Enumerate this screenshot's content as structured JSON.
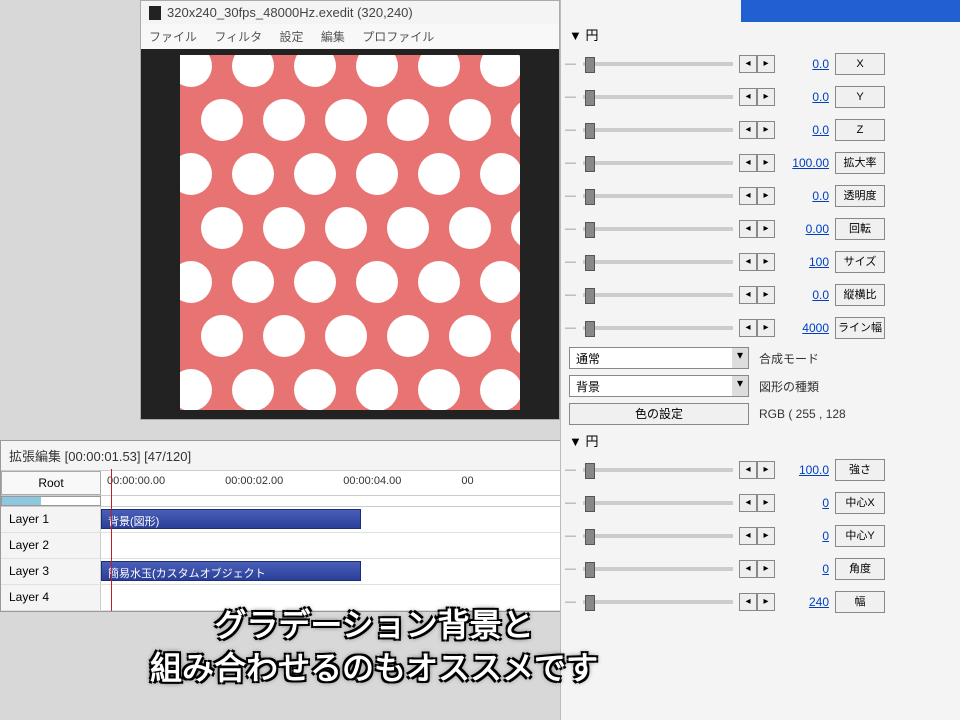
{
  "preview": {
    "title": "320x240_30fps_48000Hz.exedit (320,240)",
    "menu": [
      "ファイル",
      "フィルタ",
      "設定",
      "編集",
      "プロファイル"
    ]
  },
  "timeline": {
    "title": "拡張編集 [00:00:01.53] [47/120]",
    "root": "Root",
    "times": [
      "00:00:00.00",
      "00:00:02.00",
      "00:00:04.00",
      "00"
    ],
    "layers": [
      "Layer 1",
      "Layer 2",
      "Layer 3",
      "Layer 4"
    ],
    "clip1": "背景(図形)",
    "clip3": "簡易水玉(カスタムオブジェクト"
  },
  "panel": {
    "toggle1": "▼ 円",
    "params1": [
      {
        "val": "0.0",
        "btn": "X"
      },
      {
        "val": "0.0",
        "btn": "Y"
      },
      {
        "val": "0.0",
        "btn": "Z"
      },
      {
        "val": "100.00",
        "btn": "拡大率"
      },
      {
        "val": "0.0",
        "btn": "透明度"
      },
      {
        "val": "0.00",
        "btn": "回転"
      },
      {
        "val": "100",
        "btn": "サイズ"
      },
      {
        "val": "0.0",
        "btn": "縦横比"
      },
      {
        "val": "4000",
        "btn": "ライン幅"
      }
    ],
    "combo1": {
      "val": "通常",
      "label": "合成モード"
    },
    "combo2": {
      "val": "背景",
      "label": "図形の種類"
    },
    "colorBtn": "色の設定",
    "colorVal": "RGB ( 255 , 128",
    "toggle2": "▼ 円",
    "params2": [
      {
        "val": "100.0",
        "btn": "強さ"
      },
      {
        "val": "0",
        "btn": "中心X"
      },
      {
        "val": "0",
        "btn": "中心Y"
      },
      {
        "val": "0",
        "btn": "角度"
      },
      {
        "val": "240",
        "btn": "幅"
      }
    ]
  },
  "subtitle": {
    "line1": "グラデーション背景と",
    "line2": "組み合わせるのもオススメです"
  }
}
